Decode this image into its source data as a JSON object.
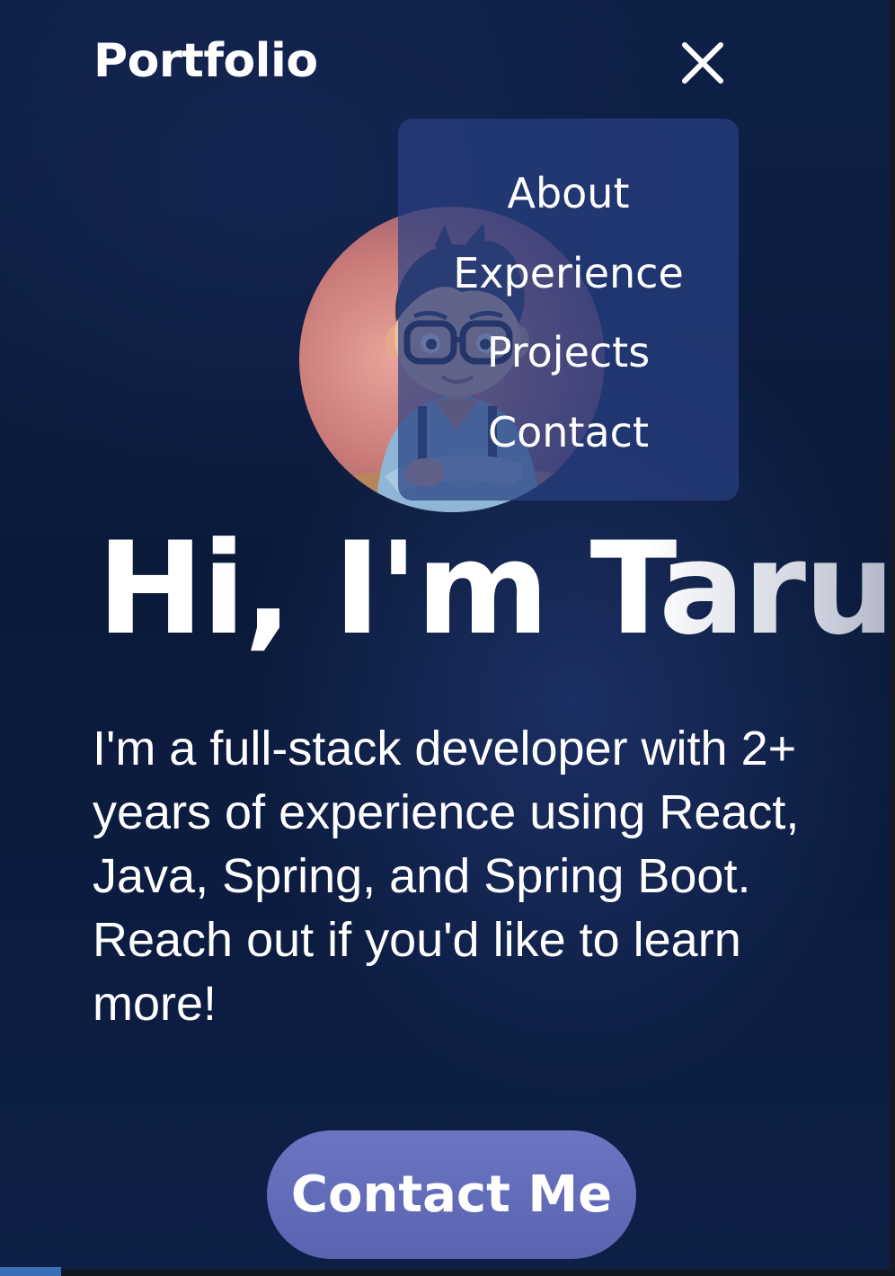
{
  "header": {
    "logo": "Portfolio",
    "close_icon": "close-icon"
  },
  "menu": {
    "items": [
      {
        "label": "About"
      },
      {
        "label": "Experience"
      },
      {
        "label": "Projects"
      },
      {
        "label": "Contact"
      }
    ]
  },
  "hero": {
    "title": "Hi, I'm Tarun",
    "description": "I'm a full-stack developer with 2+ years of experience using React, Java, Spring, and Spring Boot. Reach out if you'd like to learn more!",
    "cta_label": "Contact Me"
  },
  "colors": {
    "background": "#0b1a3a",
    "menu_bg": "#284082",
    "cta_bg": "#6068b6",
    "text": "#ffffff"
  }
}
